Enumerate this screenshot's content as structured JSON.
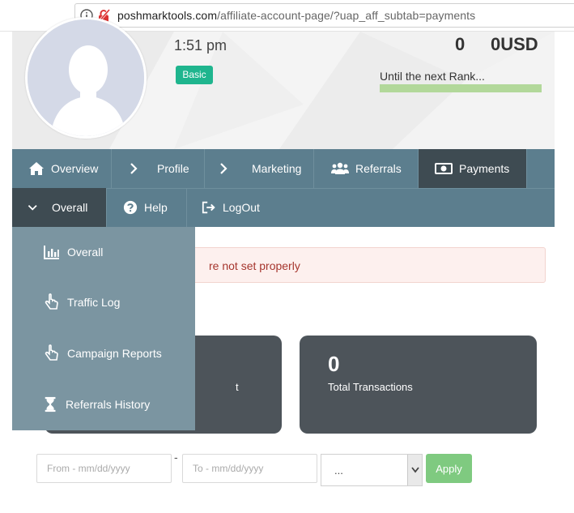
{
  "browser": {
    "url_host": "poshmarktools.com",
    "url_path": "/affiliate-account-page/?uap_aff_subtab=payments"
  },
  "header": {
    "time": "1:51 pm",
    "rank_badge": "Basic",
    "stat_count": "0",
    "stat_amount": "0USD",
    "rank_progress_label": "Until the next Rank...",
    "rank_progress_fraction": 1.0
  },
  "nav": {
    "primary": [
      "Overview",
      "Profile",
      "Marketing",
      "Referrals",
      "Payments"
    ],
    "secondary": [
      "Overall",
      "Help",
      "LogOut"
    ],
    "active_primary": "Payments"
  },
  "dropdown": {
    "items": [
      "Overall",
      "Traffic Log",
      "Campaign Reports",
      "Referrals History"
    ]
  },
  "alert": {
    "text": "re not set properly"
  },
  "cards": [
    {
      "value": "",
      "label": "t"
    },
    {
      "value": "0",
      "label": "Total Transactions"
    }
  ],
  "filter": {
    "from_placeholder": "From - mm/dd/yyyy",
    "to_placeholder": "To - mm/dd/yyyy",
    "separator": "-",
    "select_value": "...",
    "apply_label": "Apply"
  },
  "colors": {
    "nav_bg": "#5c7e8e",
    "nav_active": "#3e4b52",
    "dropdown_bg": "#7b95a1",
    "badge": "#1fb58e",
    "apply": "#7fca80",
    "card_bg": "#4d545a"
  }
}
